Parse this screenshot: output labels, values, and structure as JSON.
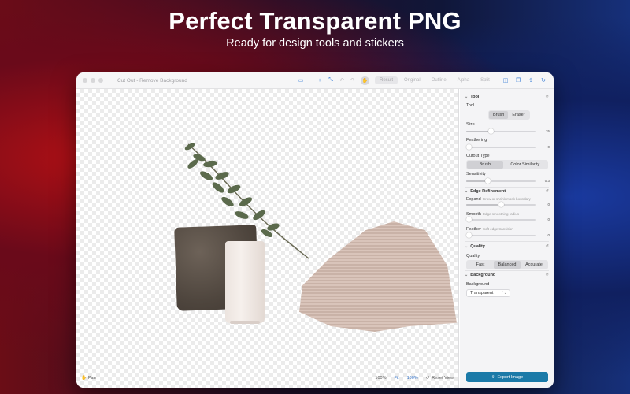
{
  "hero": {
    "title": "Perfect Transparent PNG",
    "subtitle": "Ready for design tools and stickers"
  },
  "window": {
    "title": "Cut Out - Remove Background",
    "view_modes": [
      "Result",
      "Original",
      "Outline",
      "Alpha",
      "Split"
    ],
    "active_view": "Result"
  },
  "canvas": {
    "pan_label": "Pan",
    "zoom_level": "100%",
    "fit_label": "Fit",
    "zoom_100_label": "100%",
    "reset_view_label": "Reset View"
  },
  "panel": {
    "tool_section": {
      "header": "Tool",
      "tool_label": "Tool",
      "tool_options": [
        "Brush",
        "Eraser"
      ],
      "selected_tool": "Brush",
      "size_label": "Size",
      "size_value": "35",
      "feathering_label": "Feathering",
      "feathering_value": "0",
      "cutout_type_label": "Cutout Type",
      "cutout_options": [
        "Brush",
        "Color Similarity"
      ],
      "selected_cutout": "Brush",
      "sensitivity_label": "Sensitivity",
      "sensitivity_value": "0.3"
    },
    "edge_section": {
      "header": "Edge Refinement",
      "expand_label": "Expand",
      "expand_hint": "Grow or shrink mask boundary",
      "expand_value": "0",
      "smooth_label": "Smooth",
      "smooth_hint": "Edge smoothing radius",
      "smooth_value": "0",
      "feather_label": "Feather",
      "feather_hint": "Soft edge transition",
      "feather_value": "0"
    },
    "quality_section": {
      "header": "Quality",
      "quality_label": "Quality",
      "options": [
        "Fast",
        "Balanced",
        "Accurate"
      ],
      "selected": "Balanced"
    },
    "background_section": {
      "header": "Background",
      "background_label": "Background",
      "selected": "Transparent"
    },
    "export_label": "Export Image"
  },
  "colors": {
    "accent": "#1b7aa8",
    "link": "#2e6fc7"
  }
}
